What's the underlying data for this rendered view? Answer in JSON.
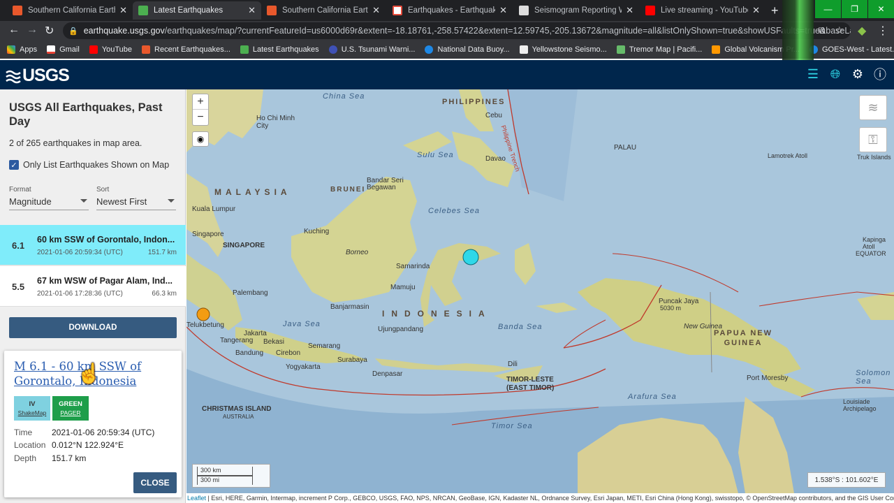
{
  "browser": {
    "tabs": [
      {
        "title": "Southern California Earthqua",
        "icon": "usgs-favicon",
        "color": "#e8582c"
      },
      {
        "title": "Latest Earthquakes",
        "icon": "earthquake-favicon",
        "color": "#4caf50"
      },
      {
        "title": "Southern California Earthqu",
        "icon": "usgs-favicon",
        "color": "#e8582c"
      },
      {
        "title": "Earthquakes - Earthquake to",
        "icon": "chart-favicon",
        "color": "#e74c3c"
      },
      {
        "title": "Seismogram Reporting Wrap",
        "icon": "seismogram-favicon",
        "color": "#666666"
      },
      {
        "title": "Live streaming - YouTube Stu",
        "icon": "youtube-favicon",
        "color": "#ff0000"
      }
    ],
    "url_domain": "earthquake.usgs.gov",
    "url_path": "/earthquakes/map/?currentFeatureId=us6000d69r&extent=-18.18761,-258.57422&extent=12.59745,-205.13672&magnitude=all&listOnlyShown=true&showUSFaults=true&baseLa...",
    "bookmarks": [
      {
        "label": "Apps",
        "icon": "apps-icon",
        "color": "#ea4335"
      },
      {
        "label": "Gmail",
        "icon": "gmail-icon",
        "color": "#ea4335"
      },
      {
        "label": "YouTube",
        "icon": "youtube-icon",
        "color": "#ff0000"
      },
      {
        "label": "Recent Earthquakes...",
        "icon": "earthquake-icon",
        "color": "#e8582c"
      },
      {
        "label": "Latest Earthquakes",
        "icon": "earthquake-icon",
        "color": "#4caf50"
      },
      {
        "label": "U.S. Tsunami Warni...",
        "icon": "noaa-icon",
        "color": "#3f51b5"
      },
      {
        "label": "National Data Buoy...",
        "icon": "noaa-icon",
        "color": "#1e88e5"
      },
      {
        "label": "Yellowstone Seismo...",
        "icon": "seismo-icon",
        "color": "#555555"
      },
      {
        "label": "Tremor Map | Pacifi...",
        "icon": "tremor-icon",
        "color": "#66bb6a"
      },
      {
        "label": "Global Volcanism Pr...",
        "icon": "volcano-icon",
        "color": "#ff9800"
      },
      {
        "label": "GOES-West - Latest...",
        "icon": "noaa-icon",
        "color": "#1e88e5"
      }
    ]
  },
  "usgs": {
    "logo_text": "USGS"
  },
  "sidebar": {
    "title": "USGS All Earthquakes, Past Day",
    "count": "2 of 265 earthquakes in map area.",
    "only_list_label": "Only List Earthquakes Shown on Map",
    "format_label": "Format",
    "format_value": "Magnitude",
    "sort_label": "Sort",
    "sort_value": "Newest First",
    "earthquakes": [
      {
        "mag": "6.1",
        "place": "60 km SSW of Gorontalo, Indon...",
        "time": "2021-01-06 20:59:34 (UTC)",
        "depth": "151.7 km",
        "selected": true
      },
      {
        "mag": "5.5",
        "place": "67 km WSW of Pagar Alam, Ind...",
        "time": "2021-01-06 17:28:36 (UTC)",
        "depth": "66.3 km",
        "selected": false
      }
    ],
    "download_label": "DOWNLOAD"
  },
  "popup": {
    "title": "M 6.1 - 60 km SSW of Gorontalo, Indonesia",
    "shakemap_level": "IV",
    "shakemap_label": "ShakeMap",
    "pager_level": "GREEN",
    "pager_label": "PAGER",
    "time_label": "Time",
    "time_value": "2021-01-06 20:59:34 (UTC)",
    "location_label": "Location",
    "location_value": "0.012°N 122.924°E",
    "depth_label": "Depth",
    "depth_value": "151.7 km",
    "close_label": "CLOSE"
  },
  "map": {
    "labels": {
      "china_sea": "China Sea",
      "philippines": "PHILIPPINES",
      "cebu": "Cebu",
      "hochiminh": "Ho Chi Minh City",
      "sulu_sea": "Sulu Sea",
      "davao": "Davao",
      "palau": "PALAU",
      "lamotrek": "Lamotrek Atoll",
      "truk": "Truk Islands",
      "malaysia": "MALAYSIA",
      "brunei": "BRUNEI",
      "bandar": "Bandar Seri Begawan",
      "celebes_sea": "Celebes Sea",
      "kuala": "Kuala Lumpur",
      "kuching": "Kuching",
      "singapore_city": "Singapore",
      "singapore": "SINGAPORE",
      "borneo": "Borneo",
      "samarinda": "Samarinda",
      "equator": "EQUATOR",
      "kapinga": "Kapinga Atoll",
      "palembang": "Palembang",
      "mamuju": "Mamuju",
      "banjarmasin": "Banjarmasin",
      "indonesia": "INDONESIA",
      "java_sea": "Java Sea",
      "banda_sea": "Banda Sea",
      "puncak": "Puncak Jaya",
      "puncak_elev": "5030 m",
      "new_guinea": "New Guinea",
      "png": "PAPUA NEW GUINEA",
      "telukbetung": "Telukbetung",
      "jakarta": "Jakarta",
      "tangerang": "Tangerang",
      "bekasi": "Bekasi",
      "ujungpandang": "Ujungpandang",
      "bandung": "Bandung",
      "cirebon": "Cirebon",
      "semarang": "Semarang",
      "yogyakarta": "Yogyakarta",
      "surabaya": "Surabaya",
      "denpasar": "Denpasar",
      "dili": "Dili",
      "timor": "TIMOR-LESTE",
      "east_timor": "(EAST TIMOR)",
      "port_moresby": "Port Moresby",
      "solomon": "Solomon Sea",
      "louisiade": "Louisiade Archipelago",
      "christmas": "CHRISTMAS ISLAND",
      "australia_small": "AUSTRALIA",
      "arafura": "Arafura Sea",
      "timor_sea": "Timor Sea",
      "trench": "Philippine Trench"
    },
    "scale_km": "300 km",
    "scale_mi": "300 mi",
    "coords": "1.538°S : 101.602°E",
    "attribution_leaflet": "Leaflet",
    "attribution_text": " | Esri, HERE, Garmin, Intermap, increment P Corp., GEBCO, USGS, FAO, NPS, NRCAN, GeoBase, IGN, Kadaster NL, Ordnance Survey, Esri Japan, METI, Esri China (Hong Kong), swisstopo, © OpenStreetMap contributors, and the GIS User Community",
    "quake_colors": {
      "recent": "#2fd8e8",
      "older": "#f39c12"
    }
  }
}
